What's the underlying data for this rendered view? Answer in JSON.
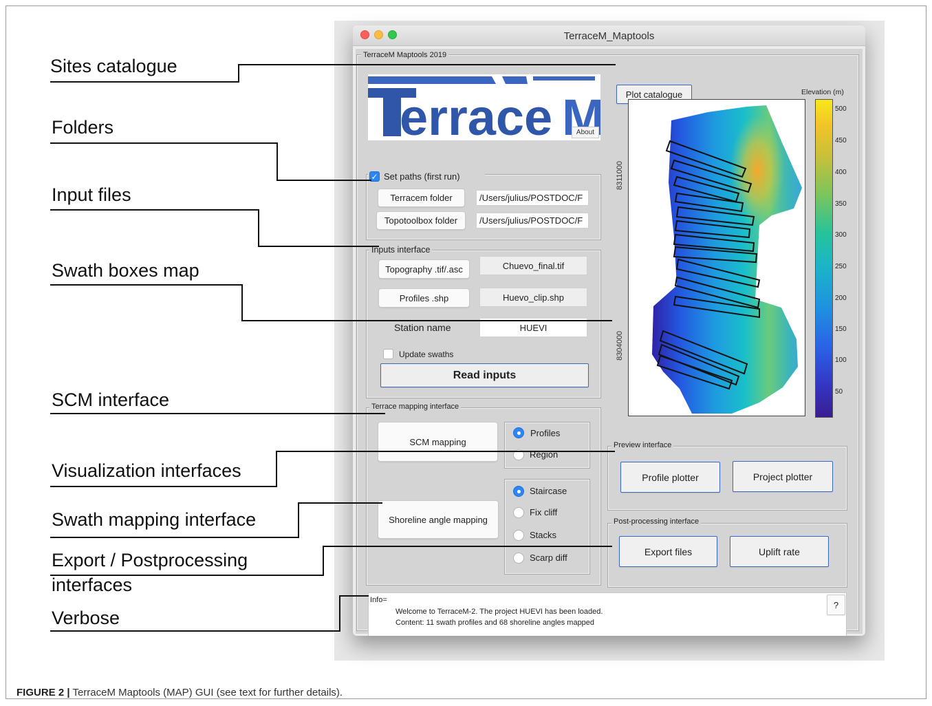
{
  "figure": {
    "caption_label": "FIGURE 2 |",
    "caption_text": " TerraceM Maptools (MAP) GUI (see text for further details)."
  },
  "window": {
    "title": "TerraceM_Maptools",
    "main_panel_title": "TerraceM Maptools 2019"
  },
  "logo": {
    "text": "TerraceM",
    "about_label": "About",
    "colors": {
      "primary": "#2f56a8",
      "accent": "#3b66c0"
    }
  },
  "paths": {
    "checkbox_label": "Set paths (first run)",
    "checked": true,
    "terracem_button": "Terracem folder",
    "terracem_path": "/Users/julius/POSTDOC/F",
    "topotoolbox_button": "Topotoolbox folder",
    "topotoolbox_path": "/Users/julius/POSTDOC/F"
  },
  "inputs": {
    "title": "Inputs interface",
    "topography_button": "Topography .tif/.asc",
    "topography_value": "Chuevo_final.tif",
    "profiles_button": "Profiles .shp",
    "profiles_value": "Huevo_clip.shp",
    "station_label": "Station name",
    "station_value": "HUEVI",
    "update_label": "Update swaths",
    "update_checked": false,
    "read_button": "Read inputs"
  },
  "terrace": {
    "title": "Terrace mapping interface",
    "scm_button": "SCM mapping",
    "scm_options": [
      {
        "label": "Profiles",
        "selected": true
      },
      {
        "label": "Region",
        "selected": false
      }
    ],
    "shoreline_button": "Shoreline angle mapping",
    "shoreline_options": [
      {
        "label": "Staircase",
        "selected": true
      },
      {
        "label": "Fix cliff",
        "selected": false
      },
      {
        "label": "Stacks",
        "selected": false
      },
      {
        "label": "Scarp diff",
        "selected": false
      }
    ]
  },
  "map": {
    "plot_catalogue_button": "Plot catalogue",
    "y_ticks": [
      "8311000",
      "8304000"
    ],
    "colorbar_title": "Elevation (m)",
    "colorbar_ticks": [
      "500",
      "450",
      "400",
      "350",
      "300",
      "250",
      "200",
      "150",
      "100",
      "50"
    ]
  },
  "preview": {
    "title": "Preview interface",
    "profile_button": "Profile plotter",
    "project_button": "Project plotter"
  },
  "post": {
    "title": "Post-processing interface",
    "export_button": "Export files",
    "uplift_button": "Uplift rate"
  },
  "info": {
    "label": "Info=",
    "line1": "Welcome to TerraceM-2. The project HUEVI has been loaded.",
    "line2": "Content: 11 swath profiles and 68 shoreline angles mapped",
    "help_button": "?"
  },
  "annotations": [
    "Sites catalogue",
    "Folders",
    "Input files",
    "Swath boxes map",
    "SCM interface",
    "Visualization interfaces",
    "Swath mapping interface",
    "Export / Postprocessing",
    "interfaces",
    "Verbose"
  ]
}
